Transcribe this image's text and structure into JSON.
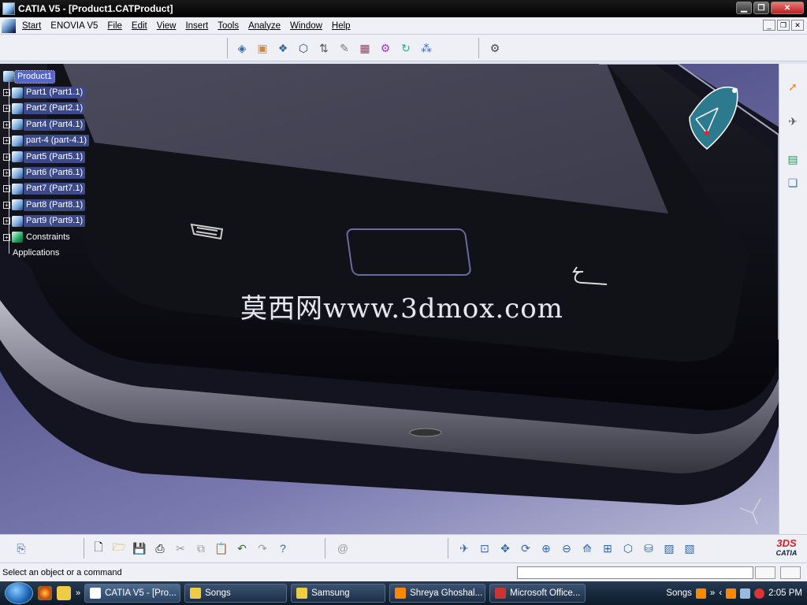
{
  "window": {
    "title": "CATIA V5 - [Product1.CATProduct]",
    "controls": [
      "minimize",
      "restore",
      "close"
    ]
  },
  "menu": {
    "items": [
      "Start",
      "ENOVIA V5",
      "File",
      "Edit",
      "View",
      "Insert",
      "Tools",
      "Analyze",
      "Window",
      "Help"
    ]
  },
  "spec_tree": {
    "root": "Product1",
    "parts": [
      "Part1 (Part1.1)",
      "Part2 (Part2.1)",
      "Part4 (Part4.1)",
      "part-4 (part-4.1)",
      "Part5 (Part5.1)",
      "Part6 (Part6.1)",
      "Part7 (Part7.1)",
      "Part8 (Part8.1)",
      "Part9 (Part9.1)"
    ],
    "constraints": "Constraints",
    "applications": "Applications"
  },
  "watermark": "莫西网www.3dmox.com",
  "status": {
    "message": "Select an object or a command",
    "command_input": ""
  },
  "brand": {
    "logo_text": "CATIA"
  },
  "taskbar": {
    "tasks": [
      "CATIA V5 - [Pro...",
      "Songs",
      "Samsung",
      "Shreya Ghoshal...",
      "Microsoft Office..."
    ],
    "tray_label": "Songs",
    "clock": "2:05 PM"
  },
  "colors": {
    "tree_label_bg": "#3d4a8a",
    "viewport_top": "#3a3a6a",
    "viewport_bottom": "#b8b8d6"
  }
}
